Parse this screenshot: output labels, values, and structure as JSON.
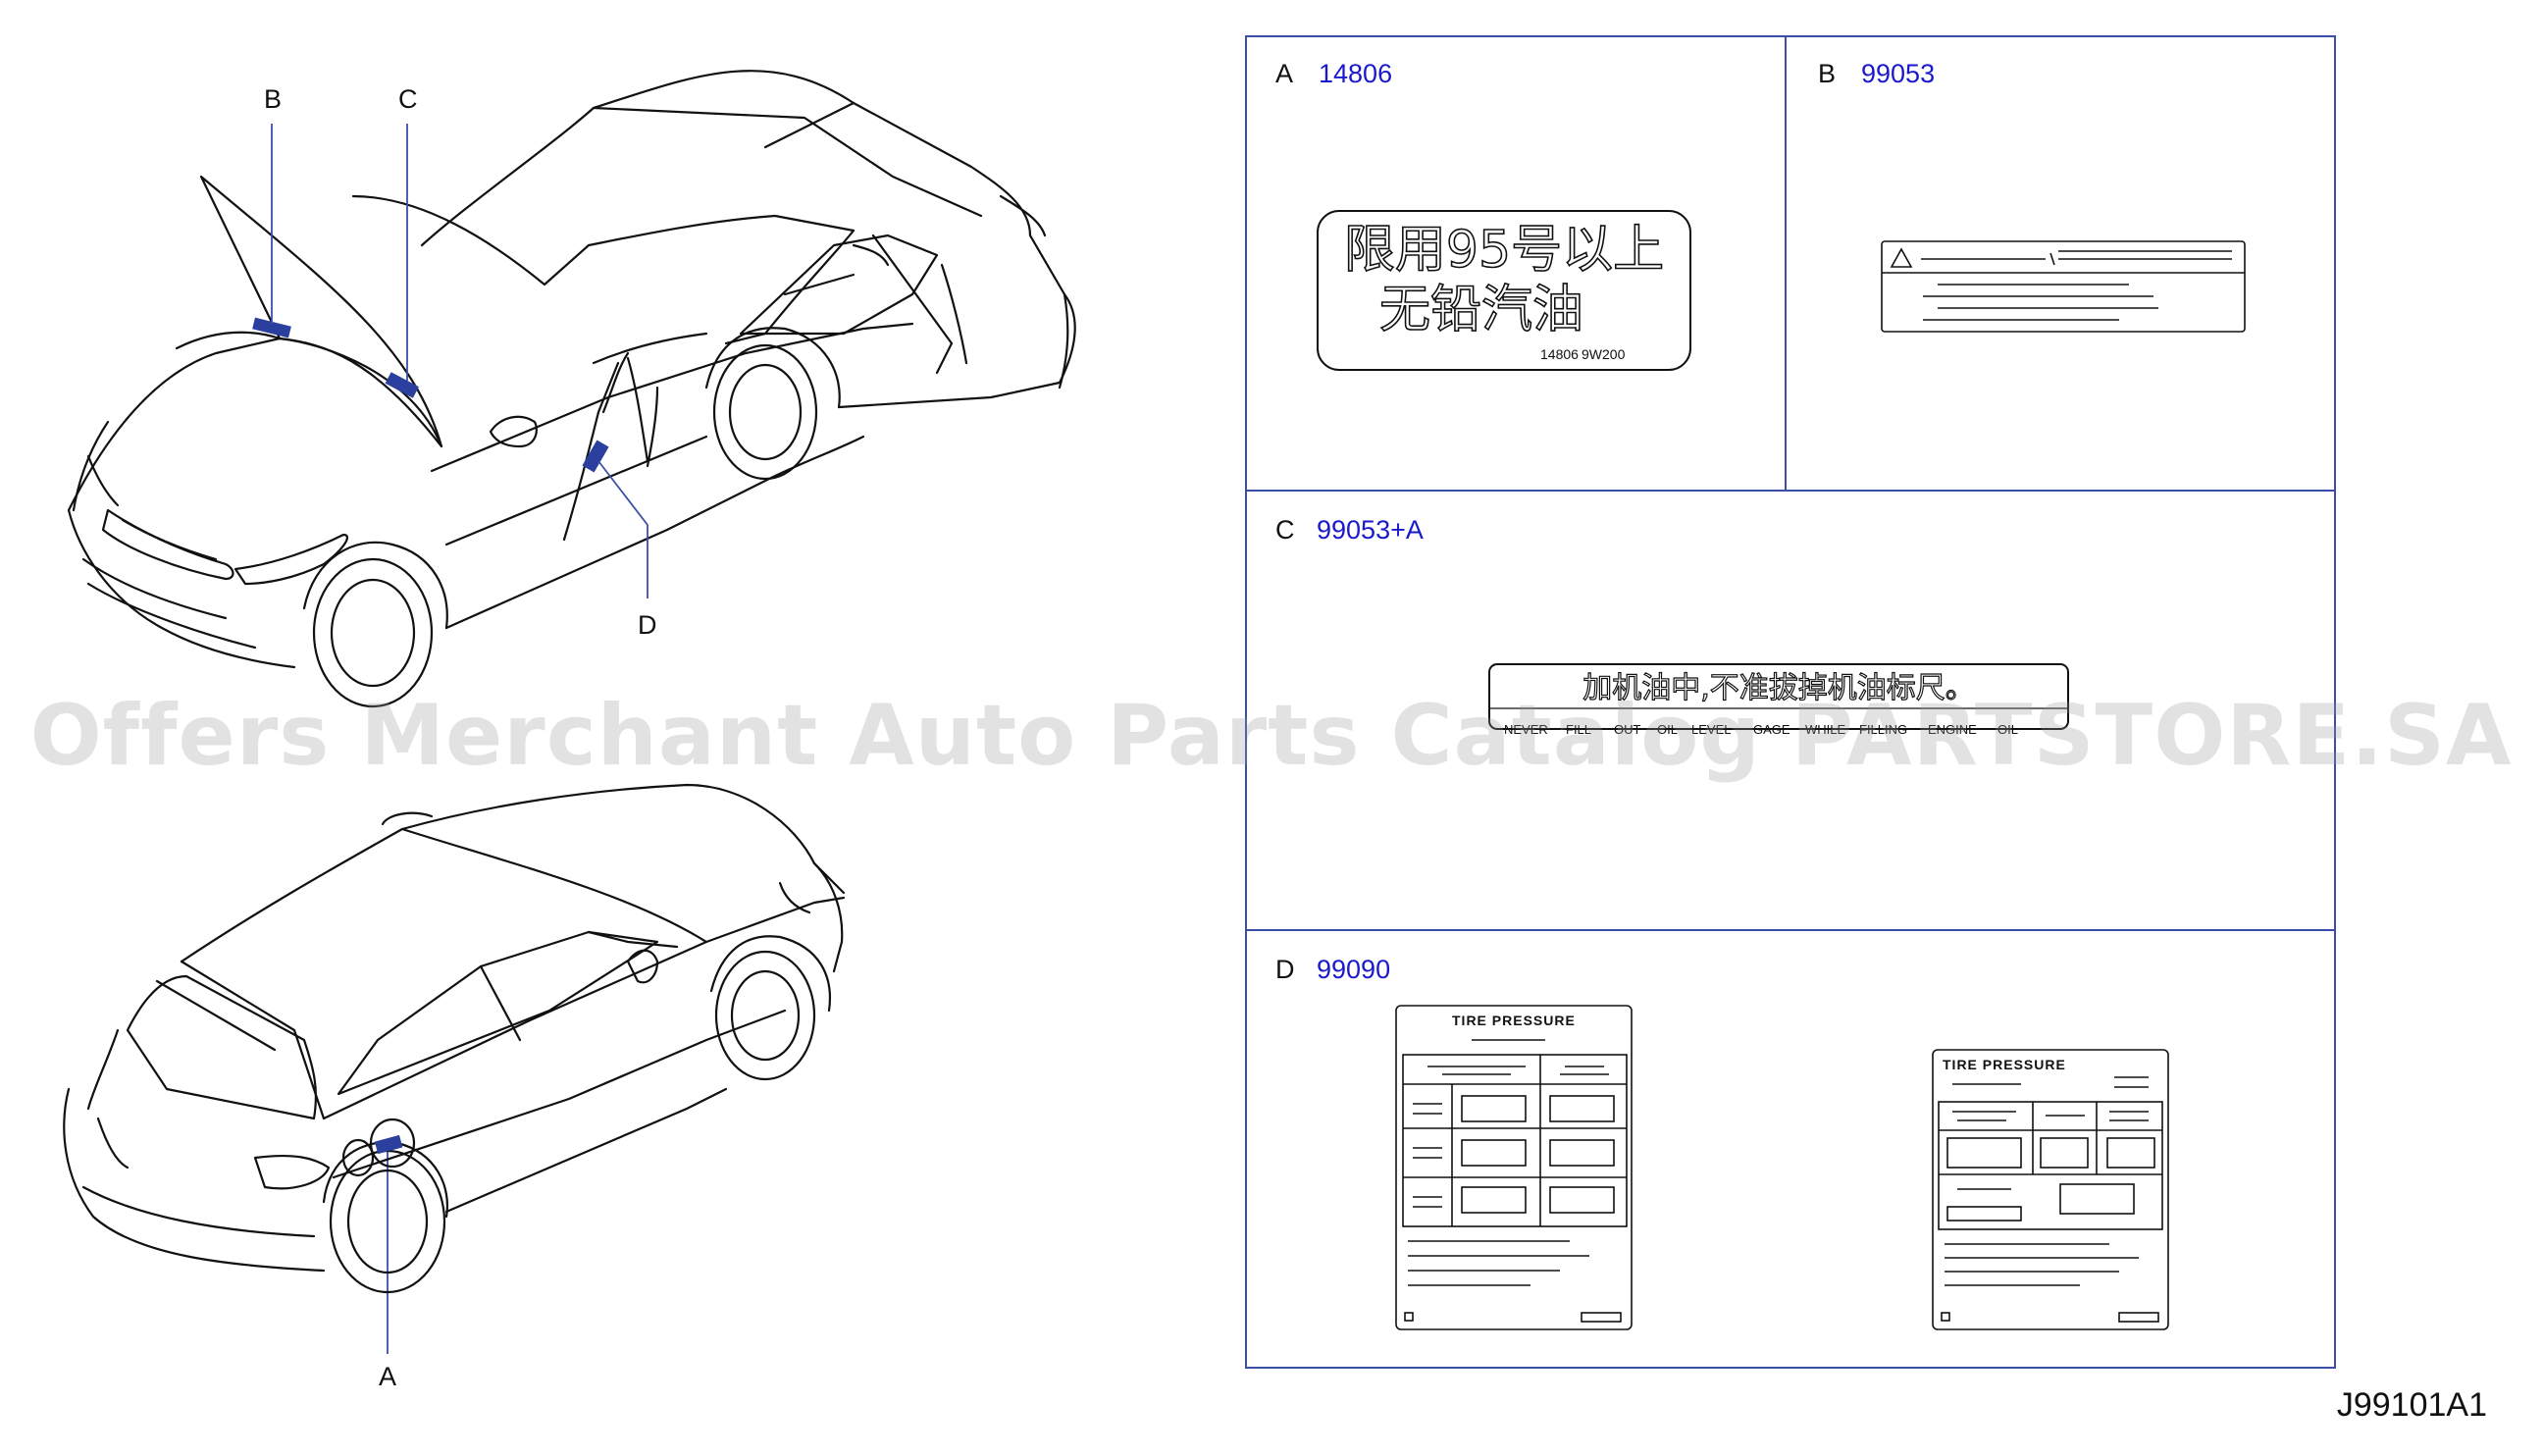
{
  "callouts": {
    "a": "A",
    "b": "B",
    "c": "C",
    "d": "D"
  },
  "panels": {
    "a": {
      "letter": "A",
      "part_no": "14806"
    },
    "b": {
      "letter": "B",
      "part_no": "99053"
    },
    "c": {
      "letter": "C",
      "part_no": "99053+A"
    },
    "d": {
      "letter": "D",
      "part_no": "99090"
    }
  },
  "label_a": {
    "line1": "限用95号以上",
    "line2": "无铅汽油",
    "code1": "14806",
    "code2": "9W200"
  },
  "label_c": {
    "line1": "加机油中,不准拔掉机油标尺。",
    "line2_words": [
      "NEVER",
      "FILL",
      "OUT",
      "OIL",
      "LEVEL",
      "GAGE",
      "WHILE",
      "FILLING",
      "ENGINE",
      "OIL"
    ]
  },
  "label_d": {
    "title": "TIRE PRESSURE"
  },
  "diagram_code": "J99101A1",
  "watermark": "Offers Merchant Auto Parts Catalog PARTSTORE.SA",
  "colors": {
    "part_no": "#1a1acc",
    "border": "#3b4fa8",
    "marker": "#2a3f9e",
    "ink": "#111111"
  }
}
